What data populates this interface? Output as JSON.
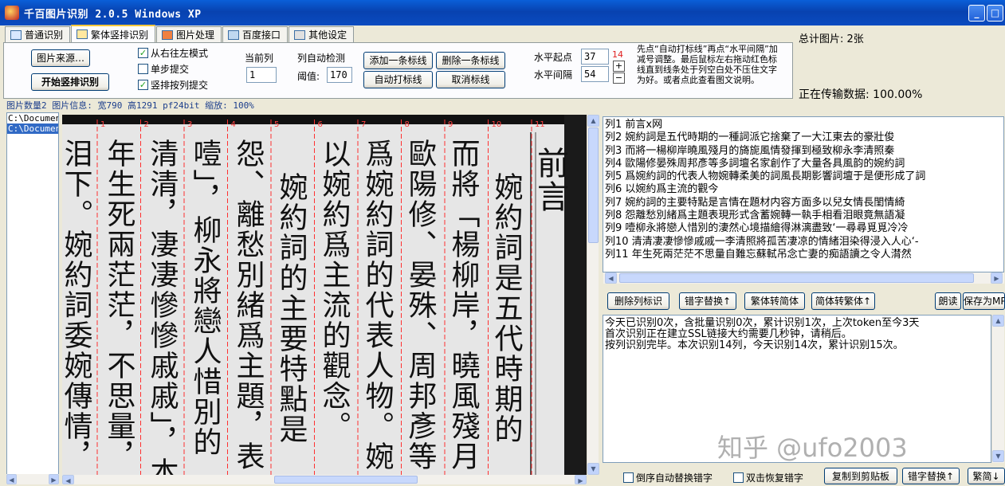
{
  "window": {
    "title": "千百图片识别 2.0.5 Windows XP"
  },
  "tabs": [
    {
      "label": "普通识别"
    },
    {
      "label": "繁体竖排识别"
    },
    {
      "label": "图片处理"
    },
    {
      "label": "百度接口"
    },
    {
      "label": "其他设定"
    }
  ],
  "toolbar": {
    "image_source": "图片来源…",
    "start_vertical": "开始竖排识别",
    "chk_rtl": "从右往左模式",
    "chk_step": "单步提交",
    "chk_column": "竖排按列提交",
    "current_col_label": "当前列",
    "current_col_value": "1",
    "auto_detect_label": "列自动检测",
    "threshold_label": "阈值:",
    "threshold_value": "170",
    "add_line": "添加一条标线",
    "del_line": "删除一条标线",
    "auto_line": "自动打标线",
    "cancel_line": "取消标线",
    "h_start_label": "水平起点",
    "h_start_value": "37",
    "h_start_red": "14",
    "h_gap_label": "水平间隔",
    "h_gap_value": "54",
    "plus": "+",
    "minus": "−",
    "hint": "先点“自动打标线”再点“水平间隔”加减号调整。最后鼠标左右拖动红色标线直到线条处于列空白处不压住文字为好。或者点此查看图文说明。"
  },
  "stats": {
    "total": "总计图片: 2张",
    "transfer": "正在传输数据: 100.00%"
  },
  "image_info": "图片数量2 图片信息: 宽790 高1291 pf24bit 缩放: 100%",
  "files": [
    "C:\\Documents",
    "C:\\Documents"
  ],
  "column_numbers": [
    "11",
    "10",
    "9",
    "8",
    "7",
    "6",
    "5",
    "4",
    "3",
    "2",
    "1"
  ],
  "image_columns": [
    "泪下。婉約詞委婉傳情，",
    "年生死兩茫茫，不思量，",
    "清清，凄凄慘慘戚戚」，本",
    "噎」，柳永將戀人惜別的",
    "怨、離愁別緒爲主題，表",
    "婉約詞的主要特點是",
    "以婉約爲主流的觀念。",
    "爲婉約詞的代表人物。婉",
    "歐陽修、晏殊、周邦彥等",
    "而將「楊柳岸，曉風殘月",
    "婉約詞是五代時期的",
    "前言"
  ],
  "results": [
    {
      "no": "列1",
      "text": "前言x网"
    },
    {
      "no": "列2",
      "text": "婉約詞是五代時期的一種詞派它捨棄了一大江東去的豪壯俊"
    },
    {
      "no": "列3",
      "text": "而將一楊柳岸曉風殘月的旖旎風情發揮到極致柳永李清照秦"
    },
    {
      "no": "列4",
      "text": "歐陽修晏殊周邦彥等多詞壇名家創作了大量各具風韵的婉約詞"
    },
    {
      "no": "列5",
      "text": "爲婉約詞的代表人物婉轉柔美的詞風長期影響詞壇于是便形成了詞"
    },
    {
      "no": "列6",
      "text": "以婉約爲主流的觀今"
    },
    {
      "no": "列7",
      "text": "婉約詞的主要特點是言情在題材内容方面多以兒女情長閨情綺"
    },
    {
      "no": "列8",
      "text": "怨離愁別緒爲主題表現形式含蓄婉轉一執手相看泪眼竟無語凝"
    },
    {
      "no": "列9",
      "text": "噎柳永將戀人惜別的淒然心境描繪得淋漓盡致‘一尋尋覓覓冷冷"
    },
    {
      "no": "列10",
      "text": "清清凄凄慘慘戚戚一李清照將孤苦凄凉的情緒泪染得浸入人心‘-"
    },
    {
      "no": "列11",
      "text": "年生死兩茫茫不思量自難忘蘇軾吊念亡妻的痴語讀之令人潸然"
    }
  ],
  "mid_buttons": {
    "del_col": "删除列标识",
    "typo_replace": "错字替换↑",
    "t2s": "繁体转简体",
    "s2t": "简体转繁体↑",
    "read": "朗读",
    "save_mp": "保存为MP"
  },
  "log": [
    "今天已识别0次，含批量识别0次，累计识别1次，上次token至今3天",
    "首次识别正在建立SSL链接大约需要几秒钟，请稍后。",
    "按列识别完毕。本次识别14列，今天识别14次，累计识别15次。"
  ],
  "bottom": {
    "chk_reverse": "倒序自动替换错字",
    "chk_dblclick": "双击恢复错字",
    "copy": "复制到剪贴板",
    "typo_replace": "错字替换↑",
    "trad": "繁简↓"
  },
  "watermark": "知乎 @ufo2003",
  "colors": {
    "titlebar": "#0842b0",
    "guide_red": "#ff3030",
    "tab_active": "#ffc83c"
  }
}
